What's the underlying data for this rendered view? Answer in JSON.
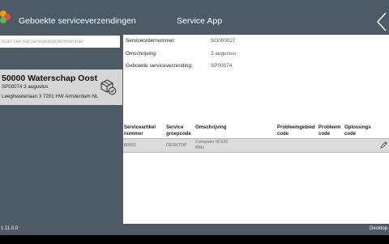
{
  "header": {
    "app_title": "Geboekte serviceverzendingen",
    "center_title": "Service App",
    "back_icon": "chevron-left-icon"
  },
  "search": {
    "placeholder": "Scan hier het serviceshipmentnummer",
    "value": ""
  },
  "shipment": {
    "title": "50000 Waterschap Oost",
    "subtitle": "SP00074 3 augustus",
    "address": "Leeghwaterlaan 3 7201 HW Amsterdam NL",
    "icon": "package-check-icon"
  },
  "details": {
    "order_label": "Serviceordernummer:",
    "order_value": "SO000027",
    "desc_label": "Omschrijving:",
    "desc_value": "3 augustus",
    "shipment_label": "Geboekte serviceverzending:",
    "shipment_value": "SP00074"
  },
  "table": {
    "headers": {
      "item_no_1": "Serviceartikel",
      "item_no_2": "nummer",
      "group_1": "Service",
      "group_2": "groepcode",
      "description": "Omschrijving",
      "problem_area_1": "Probleemgebied",
      "problem_area_2": "code",
      "problem_1": "Probleem",
      "problem_2": "code",
      "resolution_1": "Oplossings",
      "resolution_2": "code"
    },
    "rows": [
      {
        "item_no": "80001",
        "group": "DESKTOP",
        "description_1": "Computer III 533",
        "description_2": "MHz",
        "problem_area": "",
        "problem": "",
        "resolution": ""
      }
    ]
  },
  "footer": {
    "version": "1.11.0.0",
    "device": "Desktop"
  },
  "colors": {
    "chrome": "#4e5b66",
    "selected_card": "#d6d6d6",
    "selected_row": "#dcdcdc",
    "logo_orange": "#f39c12",
    "logo_red": "#e74c3c",
    "logo_green": "#6ab04c"
  }
}
